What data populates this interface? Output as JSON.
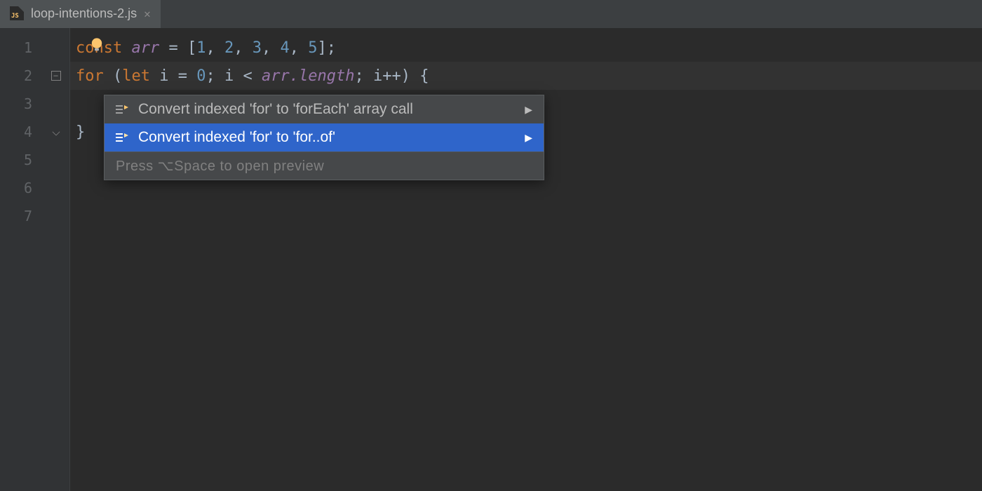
{
  "tab": {
    "filename": "loop-intentions-2.js",
    "icon_badge": "JS"
  },
  "gutter": {
    "line_numbers": [
      "1",
      "2",
      "3",
      "4",
      "5",
      "6",
      "7"
    ]
  },
  "code": {
    "line1": {
      "kw_const": "const",
      "var_arr": "arr",
      "eq": " = ",
      "lbr": "[",
      "n1": "1",
      "c1": ", ",
      "n2": "2",
      "c2": ", ",
      "n3": "3",
      "c3": ", ",
      "n4": "4",
      "c4": ", ",
      "n5": "5",
      "rbr_semi": "];"
    },
    "line2": {
      "kw_for": "for",
      "lparen": " (",
      "kw_let": "let",
      "sp1": " ",
      "id_i": "i",
      "eq": " = ",
      "n0": "0",
      "semicolon1": "; ",
      "id_i2": "i",
      "lt": " < ",
      "var_arr": "arr",
      "dot_length": ".length",
      "semicolon2": "; ",
      "id_i3": "i",
      "inc_rparen_brace": "++) {"
    },
    "line4": {
      "close_brace": "}"
    }
  },
  "popup": {
    "items": [
      {
        "label": "Convert indexed 'for' to 'forEach' array call",
        "selected": false
      },
      {
        "label": "Convert indexed 'for' to 'for..of'",
        "selected": true
      }
    ],
    "footer_hint": "Press ⌥Space to open preview"
  }
}
